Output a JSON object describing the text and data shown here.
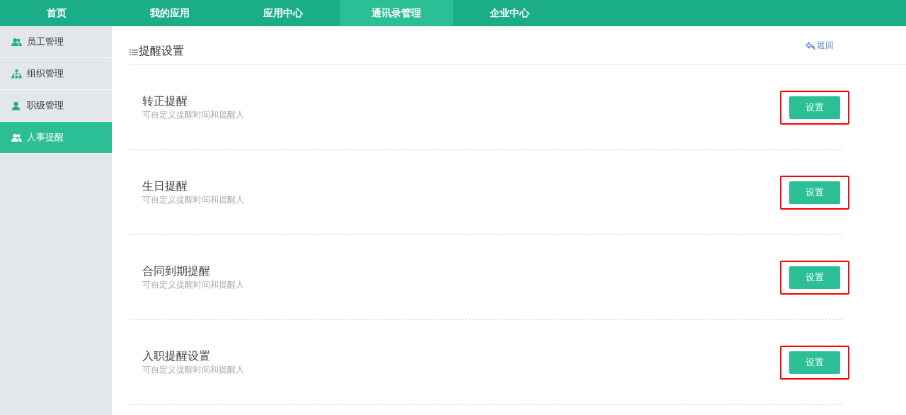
{
  "nav": [
    {
      "label": "首页",
      "selected": false
    },
    {
      "label": "我的应用",
      "selected": false
    },
    {
      "label": "应用中心",
      "selected": false
    },
    {
      "label": "通讯录管理",
      "selected": true
    },
    {
      "label": "企业中心",
      "selected": false
    }
  ],
  "sidebar": {
    "items": [
      {
        "label": "员工管理",
        "kind": "users",
        "selected": false
      },
      {
        "label": "组织管理",
        "kind": "org",
        "selected": false
      },
      {
        "label": "职级管理",
        "kind": "user",
        "selected": false
      },
      {
        "label": "人事提醒",
        "kind": "users",
        "selected": true
      }
    ]
  },
  "page": {
    "title": "提醒设置",
    "back_link": "返回"
  },
  "reminders": [
    {
      "title": "转正提醒",
      "description": "可自定义提醒时间和提醒人",
      "button": "设置",
      "highlighted": true
    },
    {
      "title": "生日提醒",
      "description": "可自定义提醒时间和提醒人",
      "button": "设置",
      "highlighted": true
    },
    {
      "title": "合同到期提醒",
      "description": "可自定义提醒时间和提醒人",
      "button": "设置",
      "highlighted": true
    },
    {
      "title": "入职提醒设置",
      "description": "可自定义提醒时间和提醒人",
      "button": "设置",
      "highlighted": true
    }
  ]
}
